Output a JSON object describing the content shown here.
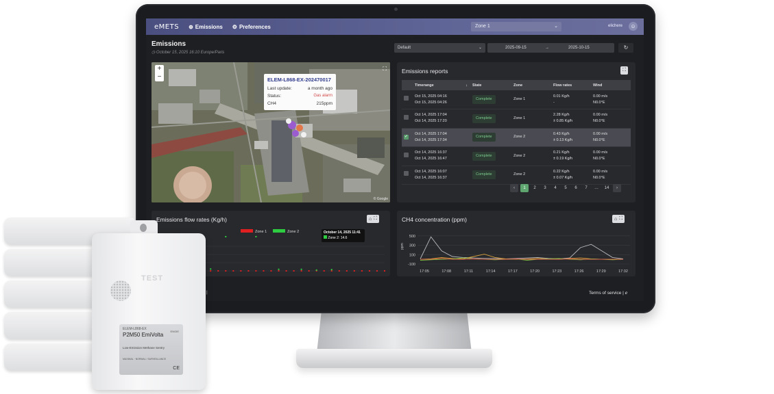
{
  "nav": {
    "logo": "eMETS",
    "links": [
      {
        "label": "Emissions"
      },
      {
        "label": "Preferences"
      }
    ],
    "zone_select": "Zone 1",
    "user": "elichere"
  },
  "header": {
    "title": "Emissions",
    "subtitle": "October 15, 2025 16:10 Europe/Paris",
    "preset": "Default",
    "date_from": "2025-09-15",
    "date_sep": "→",
    "date_to": "2025-10-15"
  },
  "map": {
    "zoom_in": "+",
    "zoom_out": "−",
    "popup": {
      "title": "ELEM-L868-EX-202470017",
      "last_update_label": "Last update:",
      "last_update": "a month ago",
      "status_label": "Status:",
      "status": "Gas alarm",
      "ch4_label": "CH4",
      "ch4": "215ppm"
    },
    "attribution": "© Google"
  },
  "reports": {
    "title": "Emissions reports",
    "columns": [
      "Timerange",
      "State",
      "Zone",
      "Flow rates",
      "Wind"
    ],
    "rows": [
      {
        "t1": "Oct 15, 2025 04:16",
        "t2": "Oct 15, 2025 04:26",
        "state": "Complete",
        "zone": "Zone 1",
        "f1": "0.01 Kg/h",
        "f2": "-",
        "w1": "0.00 m/s",
        "w2": "N0.0°E",
        "selected": false
      },
      {
        "t1": "Oct 14, 2025 17:04",
        "t2": "Oct 14, 2025 17:20",
        "state": "Complete",
        "zone": "Zone 1",
        "f1": "2.28 Kg/h",
        "f2": "± 0.85 Kg/h",
        "w1": "0.00 m/s",
        "w2": "N0.0°E",
        "selected": false
      },
      {
        "t1": "Oct 14, 2025 17:04",
        "t2": "Oct 14, 2025 17:34",
        "state": "Complete",
        "zone": "Zone 2",
        "f1": "0.43 Kg/h",
        "f2": "± 0.13 Kg/h",
        "w1": "0.00 m/s",
        "w2": "N0.0°E",
        "selected": true
      },
      {
        "t1": "Oct 14, 2025 16:37",
        "t2": "Oct 14, 2025 16:47",
        "state": "Complete",
        "zone": "Zone 2",
        "f1": "0.21 Kg/h",
        "f2": "± 0.19 Kg/h",
        "w1": "0.00 m/s",
        "w2": "N0.0°E",
        "selected": false
      },
      {
        "t1": "Oct 14, 2025 16:07",
        "t2": "Oct 14, 2025 16:37",
        "state": "Complete",
        "zone": "Zone 2",
        "f1": "0.22 Kg/h",
        "f2": "± 0.07 Kg/h",
        "w1": "0.00 m/s",
        "w2": "N0.0°E",
        "selected": false
      }
    ],
    "pages": [
      "1",
      "2",
      "3",
      "4",
      "5",
      "6",
      "7",
      "…",
      "14"
    ],
    "prev": "‹",
    "next": "›"
  },
  "flow_chart": {
    "title": "Emissions flow rates (Kg/h)",
    "tooltip_title": "October 14, 2025 11:41",
    "tooltip_value": "Zone 2: 14.6",
    "tick_partial": "14"
  },
  "ch4_chart": {
    "title": "CH4 concentration (ppm)"
  },
  "chart_data": [
    {
      "type": "scatter",
      "title": "Emissions flow rates (Kg/h)",
      "series": [
        {
          "name": "Zone 1",
          "color": "#e02020",
          "x": [
            1,
            2,
            3,
            4,
            5,
            6,
            7,
            8,
            9,
            10,
            11,
            12,
            13,
            14,
            15,
            16,
            17,
            18,
            19,
            20,
            21,
            22,
            23,
            24,
            25,
            26,
            27,
            28,
            29,
            30
          ],
          "y": [
            0,
            0,
            0,
            0,
            0,
            0,
            0,
            0,
            0,
            0,
            0,
            0,
            0,
            0,
            0,
            0,
            0,
            0,
            0,
            0,
            0,
            0,
            0,
            0,
            0,
            0,
            0,
            0,
            0,
            0
          ]
        },
        {
          "name": "Zone 2",
          "color": "#2ecc40",
          "x": [
            7,
            9,
            13,
            16,
            19,
            21,
            23,
            25
          ],
          "y": [
            1.2,
            14.6,
            11,
            1,
            1,
            0.5,
            0.8,
            14.6
          ]
        }
      ],
      "ylim": [
        0,
        16
      ]
    },
    {
      "type": "line",
      "title": "CH4 concentration (ppm)",
      "ylabel": "ppm",
      "yticks": [
        "500",
        "300",
        "100",
        "-100"
      ],
      "x": [
        "17:05",
        "17:08",
        "17:11",
        "17:14",
        "17:17",
        "17:20",
        "17:23",
        "17:26",
        "17:29",
        "17:32"
      ],
      "ylim": [
        -100,
        600
      ],
      "series": [
        {
          "color": "#b9babd",
          "values": [
            10,
            480,
            180,
            60,
            40,
            30,
            20,
            20,
            10,
            20,
            30,
            40,
            20,
            10,
            30,
            250,
            320,
            180,
            40,
            10
          ]
        },
        {
          "color": "#d4a03a",
          "values": [
            0,
            10,
            40,
            20,
            10,
            60,
            110,
            40,
            10,
            0,
            10,
            20,
            10,
            0,
            20,
            30,
            10,
            0,
            0,
            0
          ]
        },
        {
          "color": "#7bc043",
          "values": [
            -20,
            -10,
            0,
            10,
            30,
            10,
            0,
            -10,
            0,
            10,
            -20,
            0,
            10,
            20,
            0,
            -10,
            10,
            0,
            -10,
            0
          ]
        },
        {
          "color": "#e05a4a",
          "values": [
            0,
            0,
            20,
            0,
            0,
            10,
            0,
            0,
            0,
            10,
            0,
            0,
            0,
            0,
            10,
            0,
            0,
            0,
            0,
            0
          ]
        }
      ]
    }
  ],
  "footer": {
    "terms": "Terms of service",
    "sep": "|",
    "fragment": ") |"
  },
  "device": {
    "emboss": "TEST",
    "label_model": "ELEM-L868-EX",
    "label_name": "P2M50 EmiVolta",
    "label_brand": "ENGIE",
    "label_desc": "Low-Emission Methane Sentry",
    "label_small": "MAXIMAL · NORMAL / SURVEILLANCE",
    "label_ce": "CE",
    "label_brand2": "LOUEN"
  }
}
